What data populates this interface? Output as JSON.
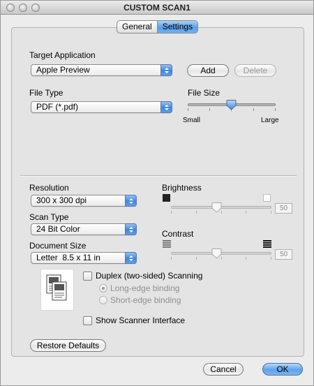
{
  "window": {
    "title": "CUSTOM SCAN1"
  },
  "tabs": [
    {
      "label": "General",
      "active": false
    },
    {
      "label": "Settings",
      "active": true
    }
  ],
  "target_application": {
    "label": "Target Application",
    "value": "Apple Preview",
    "add_label": "Add",
    "delete_label": "Delete"
  },
  "file_type": {
    "label": "File Type",
    "value": "PDF (*.pdf)"
  },
  "file_size": {
    "label": "File Size",
    "min_label": "Small",
    "max_label": "Large",
    "level": 0.5
  },
  "resolution": {
    "label": "Resolution",
    "value": "300 x 300 dpi"
  },
  "scan_type": {
    "label": "Scan Type",
    "value": "24 Bit Color"
  },
  "document_size": {
    "label": "Document Size",
    "value": "Letter  8.5 x 11 in"
  },
  "brightness": {
    "label": "Brightness",
    "value": "50",
    "level": 0.5
  },
  "contrast": {
    "label": "Contrast",
    "value": "50",
    "level": 0.5
  },
  "duplex": {
    "label": "Duplex (two-sided) Scanning",
    "checked": false,
    "long_edge": "Long-edge binding",
    "short_edge": "Short-edge binding"
  },
  "show_scanner_interface": {
    "label": "Show Scanner Interface",
    "checked": false
  },
  "footer": {
    "restore_label": "Restore Defaults",
    "cancel_label": "Cancel",
    "ok_label": "OK"
  },
  "colors": {
    "accent": "#5a9de8",
    "panel": "#e4e4e4"
  }
}
